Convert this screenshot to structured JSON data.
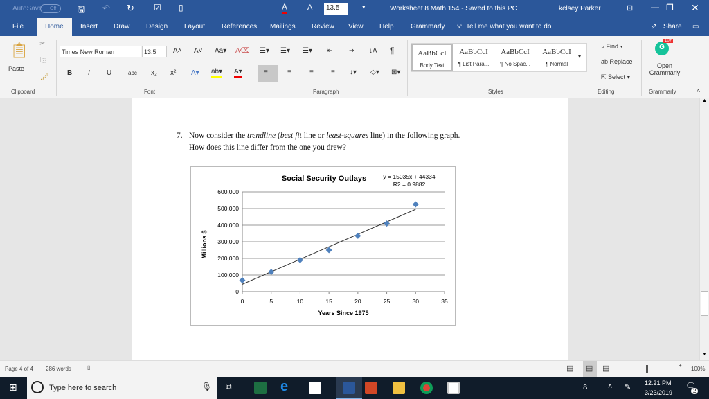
{
  "titlebar": {
    "autosave": "AutoSave",
    "autosave_state": "Off",
    "font_size": "13.5",
    "doc_title": "Worksheet 8 Math 154  -  Saved to this PC",
    "user": "kelsey Parker"
  },
  "tabs": [
    "File",
    "Home",
    "Insert",
    "Draw",
    "Design",
    "Layout",
    "References",
    "Mailings",
    "Review",
    "View",
    "Help",
    "Grammarly"
  ],
  "tell_me": "Tell me what you want to do",
  "share": "Share",
  "ribbon": {
    "paste": "Paste",
    "font_name": "Times New Roman",
    "font_size": "13.5",
    "styles": [
      {
        "sample": "AaBbCcI",
        "name": "Body Text"
      },
      {
        "sample": "AaBbCcI",
        "name": "¶ List Para..."
      },
      {
        "sample": "AaBbCcI",
        "name": "¶ No Spac..."
      },
      {
        "sample": "AaBbCcI",
        "name": "¶ Normal"
      }
    ],
    "find": "Find",
    "replace": "Replace",
    "select": "Select",
    "open_grammarly": "Open Grammarly",
    "grammarly_badge": "10+",
    "groups": {
      "clipboard": "Clipboard",
      "font": "Font",
      "paragraph": "Paragraph",
      "styles": "Styles",
      "editing": "Editing",
      "grammarly": "Grammarly"
    },
    "bold": "B",
    "italic": "I",
    "underline": "U"
  },
  "doc": {
    "num": "7.",
    "line1_a": "Now consider the ",
    "line1_b": "trendline",
    "line1_c": " (",
    "line1_d": "best fit",
    "line1_e": " line or ",
    "line1_f": "least-squares",
    "line1_g": " line) in the following graph.",
    "line2": "How does this line differ from the one you drew?"
  },
  "chart_data": {
    "type": "scatter",
    "title": "Social Security Outlays",
    "xlabel": "Years Since 1975",
    "ylabel": "Millions $",
    "equation": "y = 15035x + 44334",
    "r2": "R2 = 0.9882",
    "xlim": [
      0,
      35
    ],
    "ylim": [
      0,
      600000
    ],
    "xticks": [
      0,
      5,
      10,
      15,
      20,
      25,
      30,
      35
    ],
    "yticks": [
      "0",
      "100,000",
      "200,000",
      "300,000",
      "400,000",
      "500,000",
      "600,000"
    ],
    "x": [
      0,
      5,
      10,
      15,
      20,
      25,
      30
    ],
    "y": [
      68000,
      118000,
      190000,
      250000,
      336000,
      410000,
      525000
    ],
    "trendline": {
      "slope": 15035,
      "intercept": 44334,
      "x_range": [
        0,
        30
      ]
    },
    "color": "#4f81bd",
    "grid": true
  },
  "status": {
    "page": "Page 4 of 4",
    "words": "286 words",
    "zoom": "100%"
  },
  "taskbar": {
    "search": "Type here to search",
    "time": "12:21 PM",
    "date": "3/23/2019",
    "notif": "2"
  }
}
